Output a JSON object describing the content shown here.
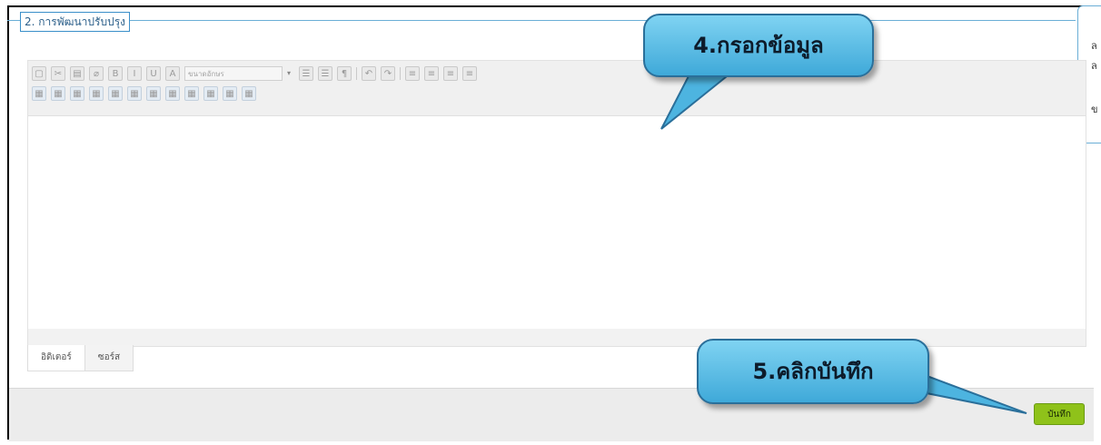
{
  "section": {
    "legend": "2. การพัฒนาปรับปรุง"
  },
  "right_panel": {
    "chars": [
      "ล",
      "ล",
      "ข"
    ]
  },
  "toolbar": {
    "font_size_placeholder": "ขนาดอักษร",
    "row1_icons": [
      "new-document-icon",
      "cut-icon",
      "paste-icon",
      "eraser-icon",
      "bold-icon",
      "italic-icon",
      "underline-icon",
      "font-color-icon"
    ],
    "row1_glyphs": [
      "▢",
      "✂",
      "▤",
      "⌀",
      "B",
      "I",
      "U",
      "A"
    ],
    "row1b_icons": [
      "ordered-list-icon",
      "unordered-list-icon",
      "paragraph-icon",
      "undo-icon",
      "redo-icon",
      "align-left-icon",
      "align-center-icon",
      "align-right-icon",
      "align-justify-icon"
    ],
    "row1b_glyphs": [
      "☰",
      "☰",
      "¶",
      "↶",
      "↷",
      "≡",
      "≡",
      "≡",
      "≡"
    ],
    "row2_icons": [
      "insert-table-icon",
      "table-properties-icon",
      "insert-row-icon",
      "insert-column-icon",
      "delete-row-icon",
      "delete-column-icon",
      "merge-cells-icon",
      "split-cells-icon",
      "cell-color-icon",
      "table-borders-icon",
      "table-grid-icon",
      "table-delete-icon"
    ],
    "row2_glyphs": [
      "▦",
      "▦",
      "▦",
      "▦",
      "▦",
      "▦",
      "▦",
      "▦",
      "▦",
      "▦",
      "▦",
      "▦"
    ]
  },
  "tabs": {
    "editor": "อิดิเตอร์",
    "source": "ซอร์ส"
  },
  "footer": {
    "save_label": "บันทึก"
  },
  "callouts": {
    "step4": "4.กรอกข้อมูล",
    "step5": "5.คลิกบันทึก"
  },
  "colors": {
    "accent": "#3a8fc9",
    "save_green": "#8fc21a",
    "callout_fill": "#5bbfe8"
  }
}
